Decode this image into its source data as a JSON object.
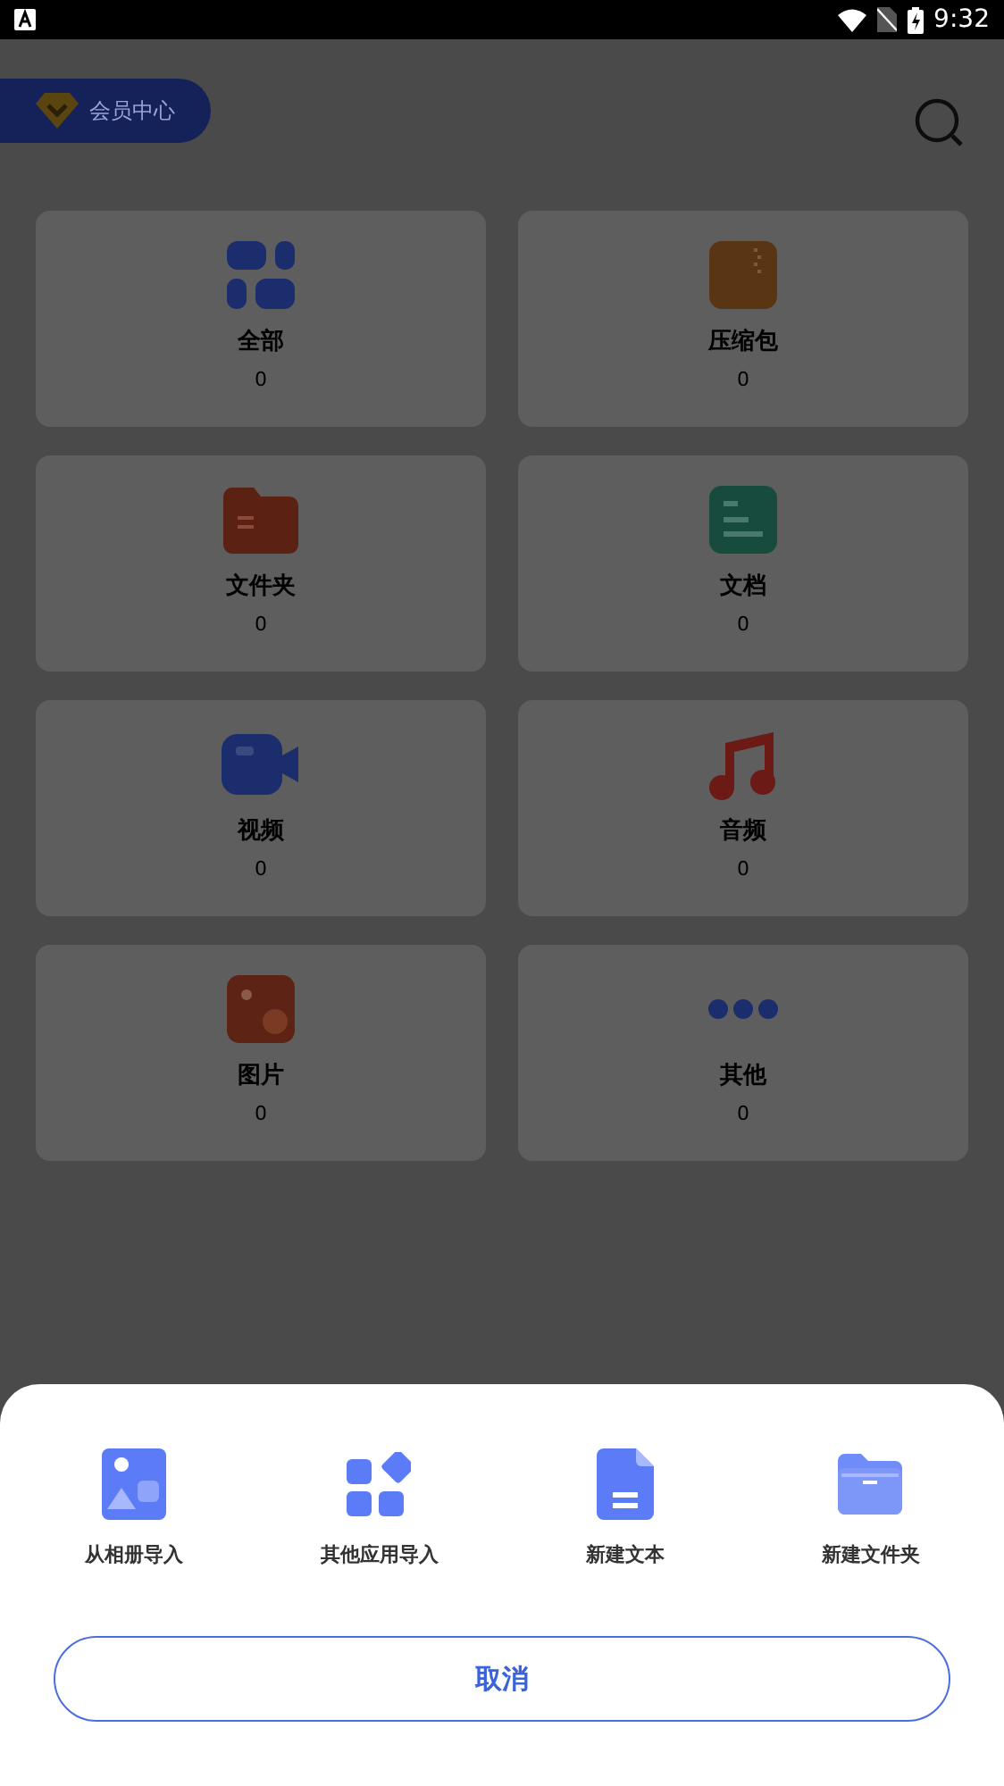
{
  "status_bar": {
    "time": "9:32"
  },
  "header": {
    "member_button": "会员中心"
  },
  "categories": [
    {
      "kind": "all",
      "label": "全部",
      "count": "0"
    },
    {
      "kind": "archive",
      "label": "压缩包",
      "count": "0"
    },
    {
      "kind": "folder",
      "label": "文件夹",
      "count": "0"
    },
    {
      "kind": "document",
      "label": "文档",
      "count": "0"
    },
    {
      "kind": "video",
      "label": "视频",
      "count": "0"
    },
    {
      "kind": "audio",
      "label": "音频",
      "count": "0"
    },
    {
      "kind": "image",
      "label": "图片",
      "count": "0"
    },
    {
      "kind": "other",
      "label": "其他",
      "count": "0"
    }
  ],
  "sheet": {
    "actions": [
      {
        "kind": "album",
        "label": "从相册导入"
      },
      {
        "kind": "apps",
        "label": "其他应用导入"
      },
      {
        "kind": "text",
        "label": "新建文本"
      },
      {
        "kind": "folder",
        "label": "新建文件夹"
      }
    ],
    "cancel": "取消"
  }
}
